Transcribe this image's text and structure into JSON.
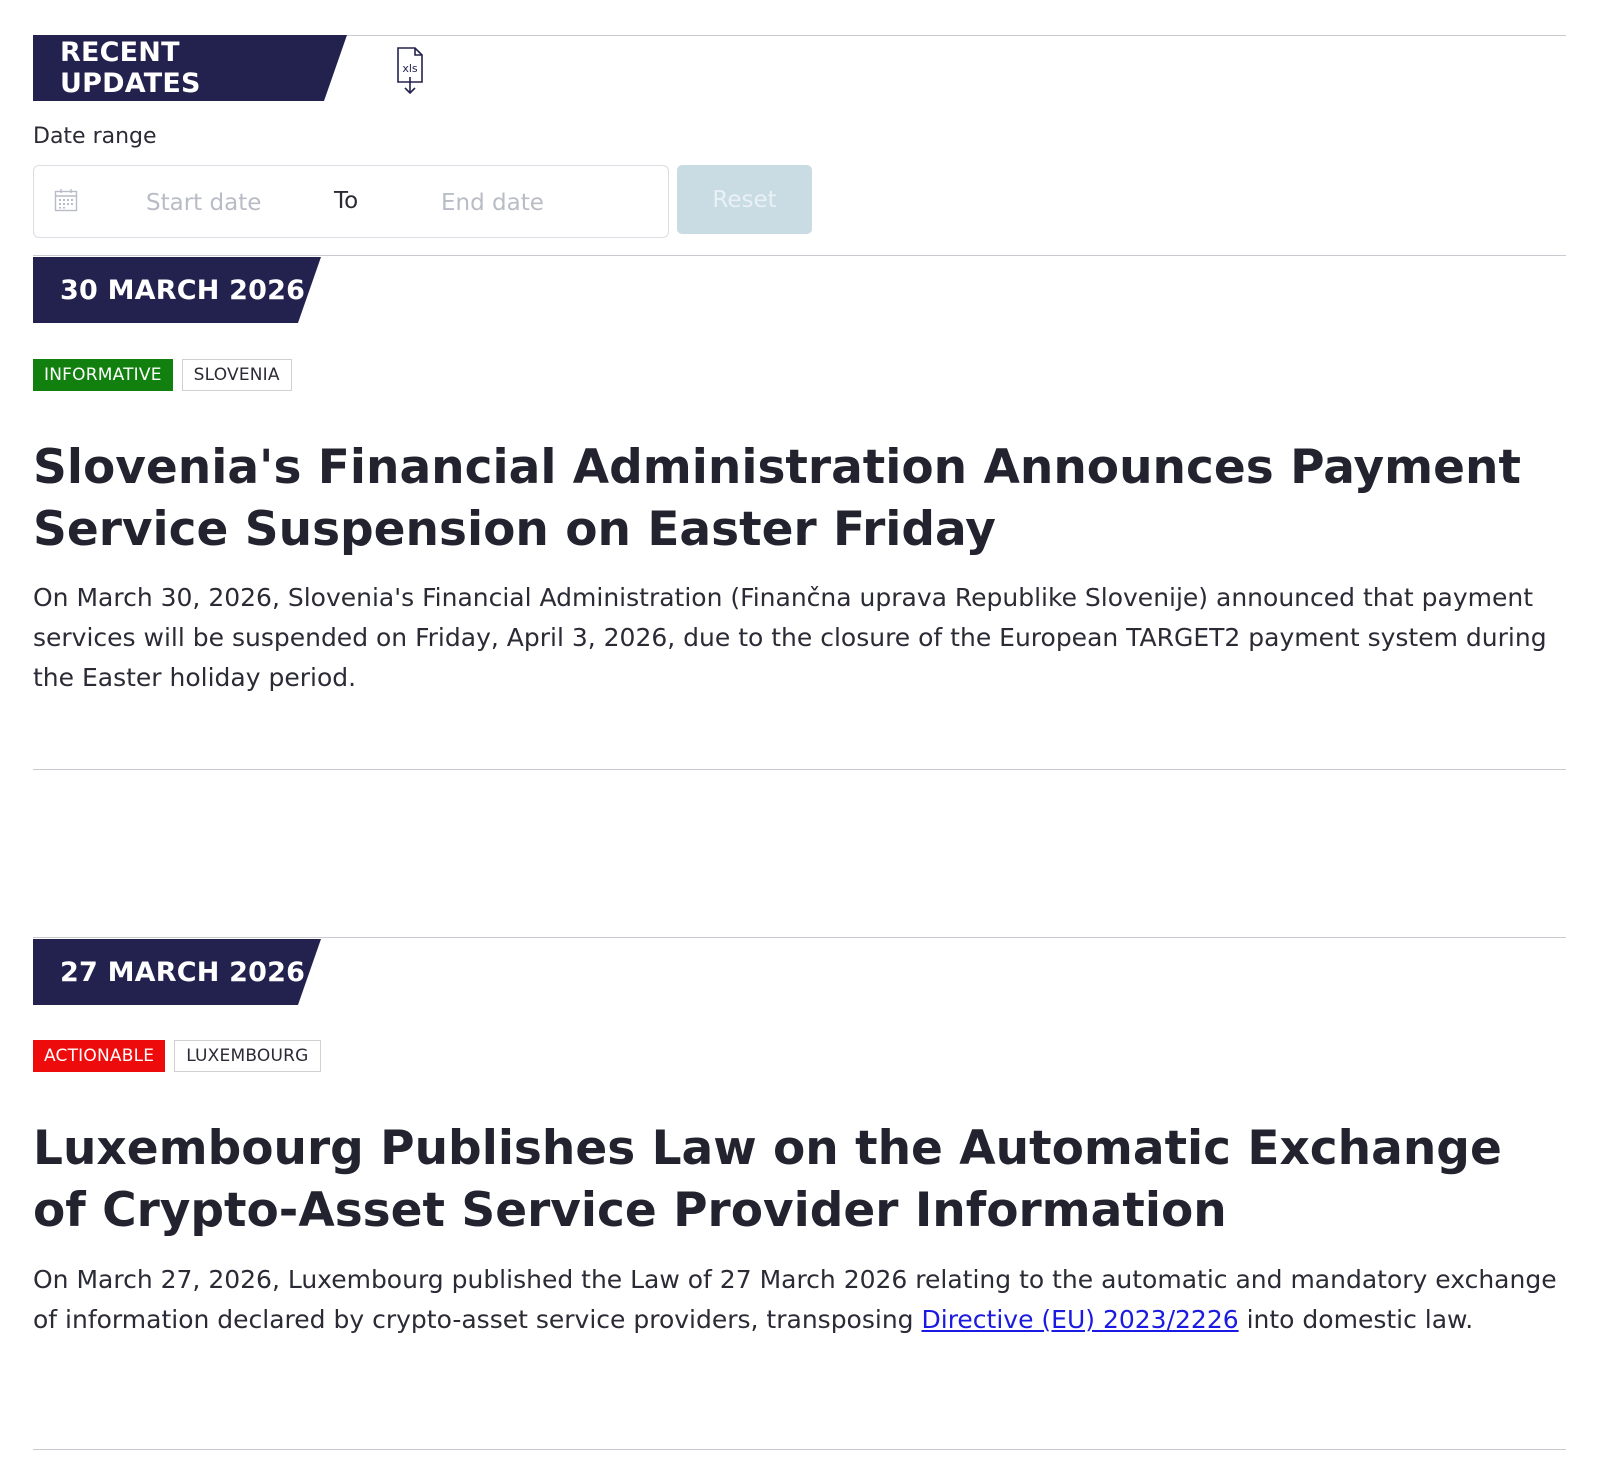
{
  "header": {
    "title": "RECENT UPDATES",
    "export_icon_label": "xls"
  },
  "filter": {
    "date_range_label": "Date range",
    "start_placeholder": "Start date",
    "to_label": "To",
    "end_placeholder": "End date",
    "reset_label": "Reset"
  },
  "updates": [
    {
      "date": "30 MARCH 2026",
      "type_tag": "INFORMATIVE",
      "country_tag": "SLOVENIA",
      "title": "Slovenia's Financial Administration Announces Payment Service Suspension on Easter Friday",
      "body": "On March 30, 2026, Slovenia's Financial Administration (Finančna uprava Republike Slovenije) announced that payment services will be suspended on Friday, April 3, 2026, due to the closure of the European TARGET2 payment system during the Easter holiday period."
    },
    {
      "date": "27 MARCH 2026",
      "type_tag": "ACTIONABLE",
      "country_tag": "LUXEMBOURG",
      "title": "Luxembourg Publishes Law on the Automatic Exchange of Crypto-Asset Service Provider Information",
      "body_before_link": "On March 27, 2026, Luxembourg published the Law of 27 March 2026 relating to the automatic and mandatory exchange of information declared by crypto-asset service providers, transposing ",
      "link_text": "Directive (EU) 2023/2226",
      "body_after_link": " into domestic law."
    }
  ],
  "colors": {
    "banner": "#23224f",
    "informative": "#12800f",
    "actionable": "#ee0b0b",
    "link": "#1a1ae0",
    "reset_disabled": "#c9dbe3"
  }
}
